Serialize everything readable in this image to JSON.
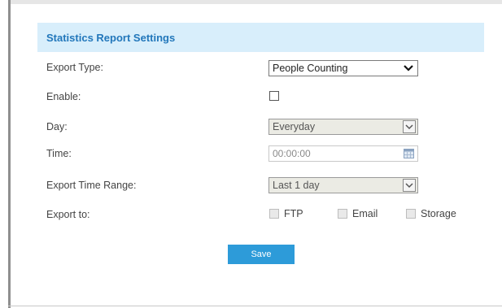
{
  "section": {
    "title": "Statistics Report Settings"
  },
  "fields": {
    "export_type": {
      "label": "Export Type:",
      "value": "People Counting"
    },
    "enable": {
      "label": "Enable:",
      "checked": false
    },
    "day": {
      "label": "Day:",
      "value": "Everyday"
    },
    "time": {
      "label": "Time:",
      "value": "00:00:00"
    },
    "export_time_range": {
      "label": "Export Time Range:",
      "value": "Last 1 day"
    },
    "export_to": {
      "label": "Export to:",
      "options": [
        {
          "label": "FTP",
          "checked": false
        },
        {
          "label": "Email",
          "checked": false
        },
        {
          "label": "Storage",
          "checked": false
        }
      ]
    }
  },
  "actions": {
    "save_label": "Save"
  },
  "icons": {
    "dropdown": "chevron-down-icon",
    "calendar": "calendar-icon"
  },
  "colors": {
    "header_bg": "#d8eefb",
    "header_text": "#2277bb",
    "save_bg": "#2d9bd9"
  }
}
